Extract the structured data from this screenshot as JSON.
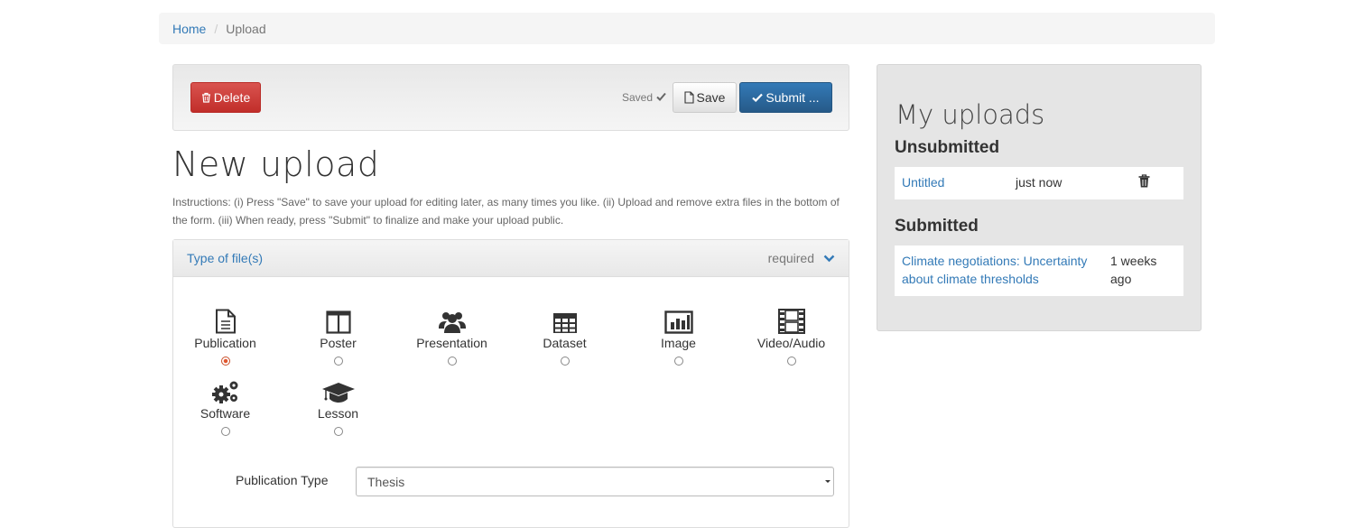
{
  "breadcrumb": {
    "home": "Home",
    "current": "Upload"
  },
  "toolbar": {
    "delete_label": "Delete",
    "saved_status": "Saved",
    "save_label": "Save",
    "submit_label": "Submit ..."
  },
  "page": {
    "title": "New upload",
    "instructions": "Instructions: (i) Press \"Save\" to save your upload for editing later, as many times you like. (ii) Upload and remove extra files in the bottom of the form. (iii) When ready, press \"Submit\" to finalize and make your upload public."
  },
  "type_panel": {
    "title": "Type of file(s)",
    "required_label": "required",
    "types": [
      {
        "label": "Publication",
        "icon": "file-text-icon",
        "checked": true
      },
      {
        "label": "Poster",
        "icon": "columns-icon",
        "checked": false
      },
      {
        "label": "Presentation",
        "icon": "group-icon",
        "checked": false
      },
      {
        "label": "Dataset",
        "icon": "table-icon",
        "checked": false
      },
      {
        "label": "Image",
        "icon": "bar-chart-icon",
        "checked": false
      },
      {
        "label": "Video/Audio",
        "icon": "film-icon",
        "checked": false
      },
      {
        "label": "Software",
        "icon": "gears-icon",
        "checked": false
      },
      {
        "label": "Lesson",
        "icon": "graduation-cap-icon",
        "checked": false
      }
    ],
    "publication_type_label": "Publication Type",
    "publication_type_value": "Thesis"
  },
  "sidebar": {
    "title": "My uploads",
    "unsubmitted_heading": "Unsubmitted",
    "unsubmitted": [
      {
        "title": "Untitled",
        "time": "just now"
      }
    ],
    "submitted_heading": "Submitted",
    "submitted": [
      {
        "title_line1": "Climate negotiations: Uncertainty",
        "title_line2": "about climate thresholds",
        "time_line1": "1 weeks",
        "time_line2": "ago"
      }
    ]
  },
  "colors": {
    "link": "#337ab7",
    "danger": "#d9534f",
    "primary": "#337ab7",
    "radio_checked": "#e0562f"
  }
}
